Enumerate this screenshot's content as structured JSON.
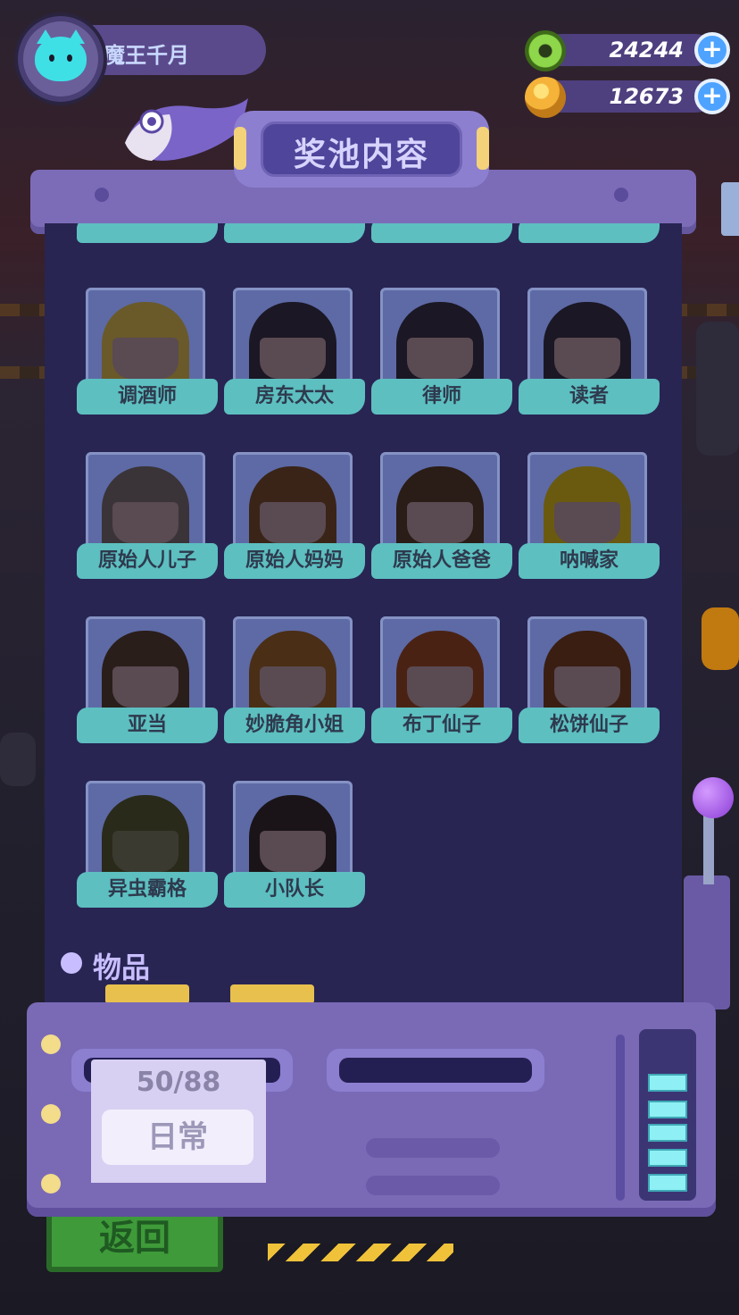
{
  "player": {
    "name": "魔王千月"
  },
  "currencies": [
    {
      "icon": "donut-icon",
      "value": "24244"
    },
    {
      "icon": "planet-icon",
      "value": "12673"
    }
  ],
  "panel": {
    "title": "奖池内容",
    "partial_row": [
      "",
      "",
      "",
      ""
    ],
    "characters": [
      "调酒师",
      "房东太太",
      "律师",
      "读者",
      "原始人儿子",
      "原始人妈妈",
      "原始人爸爸",
      "呐喊家",
      "亚当",
      "妙脆角小姐",
      "布丁仙子",
      "松饼仙子",
      "异虫霸格",
      "小队长"
    ],
    "items_section": "物品"
  },
  "machine": {
    "progress": "50/88",
    "mode": "日常"
  },
  "footer": {
    "back_label": "返回"
  },
  "colors": {
    "panel_bg": "#282553",
    "label_teal": "#5dbfc0",
    "frame_purple": "#7c6cb8"
  }
}
